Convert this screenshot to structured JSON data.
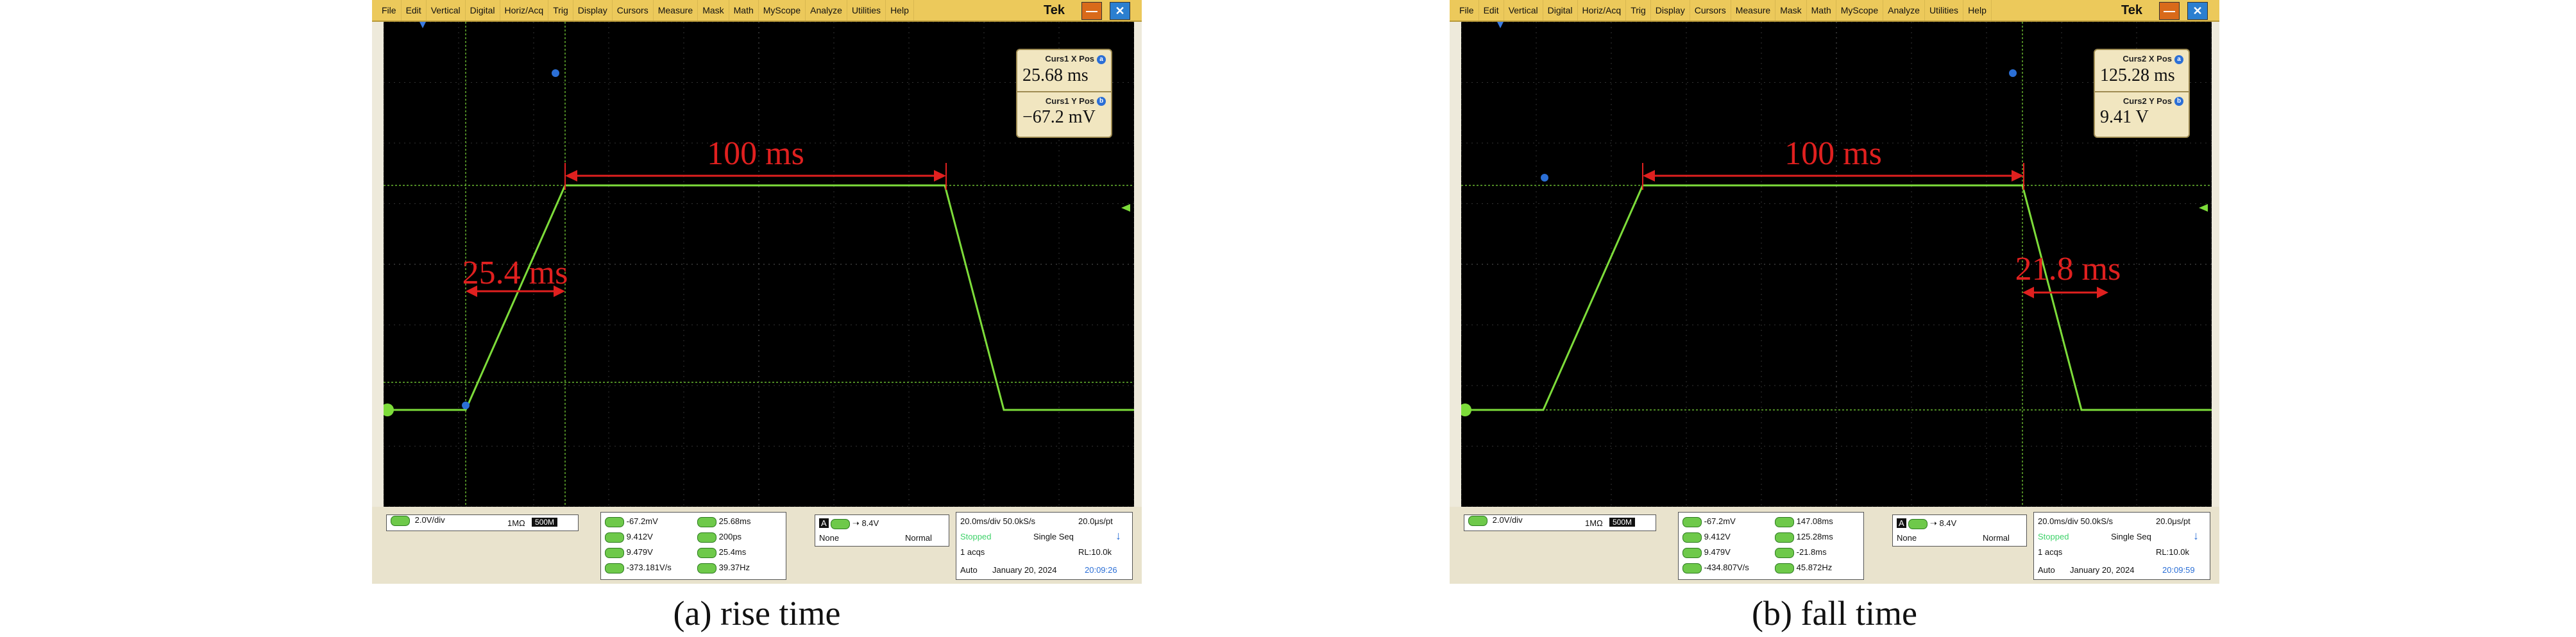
{
  "menu": [
    "File",
    "Edit",
    "Vertical",
    "Digital",
    "Horiz/Acq",
    "Trig",
    "Display",
    "Cursors",
    "Measure",
    "Mask",
    "Math",
    "MyScope",
    "Analyze",
    "Utilities",
    "Help"
  ],
  "brand": "Tek",
  "colors": {
    "trace": "#7ddc3a",
    "annotation": "#e0201f",
    "grid": "#3a3a3a",
    "menubar": "#ecc95b"
  },
  "panels": [
    {
      "caption": "(a) rise time",
      "annot_width": "100 ms",
      "annot_edge": "25.4 ms",
      "readout": {
        "x_label": "Curs1 X Pos",
        "x_value": "25.68 ms",
        "y_label": "Curs1 Y Pos",
        "y_value": "−67.2 mV"
      },
      "channel": {
        "vdiv": "2.0V/div",
        "imp": "1MΩ",
        "bw": "500M"
      },
      "meas_left": [
        "-67.2mV",
        "9.412V",
        "9.479V",
        "-373.181V/s"
      ],
      "meas_right": [
        "25.68ms",
        "200ps",
        "25.4ms",
        "39.37Hz"
      ],
      "trigger": {
        "src": "A",
        "level": "8.4V",
        "mode": "None",
        "type": "Normal"
      },
      "timebase": {
        "line1": "20.0ms/div 50.0kS/s",
        "pt": "20.0μs/pt",
        "run": "Stopped",
        "seq": "Single Seq",
        "acqs": "1 acqs",
        "rl": "RL:10.0k",
        "auto": "Auto",
        "date": "January 20, 2024",
        "time": "20:09:26"
      }
    },
    {
      "caption": "(b) fall time",
      "annot_width": "100 ms",
      "annot_edge": "21.8 ms",
      "readout": {
        "x_label": "Curs2 X Pos",
        "x_value": "125.28 ms",
        "y_label": "Curs2 Y Pos",
        "y_value": "9.41 V"
      },
      "channel": {
        "vdiv": "2.0V/div",
        "imp": "1MΩ",
        "bw": "500M"
      },
      "meas_left": [
        "-67.2mV",
        "9.412V",
        "9.479V",
        "-434.807V/s"
      ],
      "meas_right": [
        "147.08ms",
        "125.28ms",
        "-21.8ms",
        "45.872Hz"
      ],
      "trigger": {
        "src": "A",
        "level": "8.4V",
        "mode": "None",
        "type": "Normal"
      },
      "timebase": {
        "line1": "20.0ms/div 50.0kS/s",
        "pt": "20.0μs/pt",
        "run": "Stopped",
        "seq": "Single Seq",
        "acqs": "1 acqs",
        "rl": "RL:10.0k",
        "auto": "Auto",
        "date": "January 20, 2024",
        "time": "20:09:59"
      }
    }
  ]
}
